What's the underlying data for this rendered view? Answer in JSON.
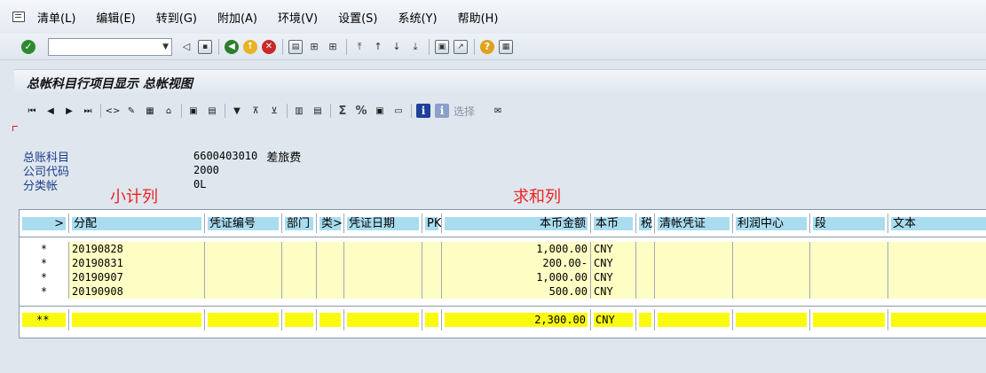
{
  "menu": {
    "items": [
      "清单(L)",
      "编辑(E)",
      "转到(G)",
      "附加(A)",
      "环境(V)",
      "设置(S)",
      "系统(Y)",
      "帮助(H)"
    ]
  },
  "toolbar": {
    "command_field_value": "",
    "icons": [
      "enter-icon",
      "back-icon",
      "save-icon",
      "back-green-icon",
      "exit-icon",
      "cancel-icon",
      "print-icon",
      "find-icon",
      "find-next-icon",
      "first-page-icon",
      "prev-page-icon",
      "next-page-icon",
      "last-page-icon",
      "create-session-icon",
      "shortcut-icon",
      "help-icon",
      "customize-icon"
    ]
  },
  "title": "总帐科目行项目显示 总帐视图",
  "app_toolbar": {
    "select_label": "选择"
  },
  "header": {
    "account_label": "总账科目",
    "account_value": "6600403010",
    "account_desc": "差旅费",
    "company_label": "公司代码",
    "company_value": "2000",
    "ledger_label": "分类帐",
    "ledger_value": "0L"
  },
  "annotations": {
    "subtotal_col": "小计列",
    "sum_col": "求和列"
  },
  "grid": {
    "columns": [
      "分配",
      "凭证编号",
      "部门",
      "类>",
      "凭证日期",
      "PK",
      "本币金额",
      "本币",
      "税",
      "清帐凭证",
      "利润中心",
      "段",
      "文本"
    ],
    "rows": [
      {
        "marker": "*",
        "assignment": "20190828",
        "amount": "1,000.00",
        "currency": "CNY"
      },
      {
        "marker": "*",
        "assignment": "20190831",
        "amount": "200.00-",
        "currency": "CNY"
      },
      {
        "marker": "*",
        "assignment": "20190907",
        "amount": "1,000.00",
        "currency": "CNY"
      },
      {
        "marker": "*",
        "assignment": "20190908",
        "amount": "500.00",
        "currency": "CNY"
      }
    ],
    "total": {
      "marker": "**",
      "amount": "2,300.00",
      "currency": "CNY"
    }
  }
}
